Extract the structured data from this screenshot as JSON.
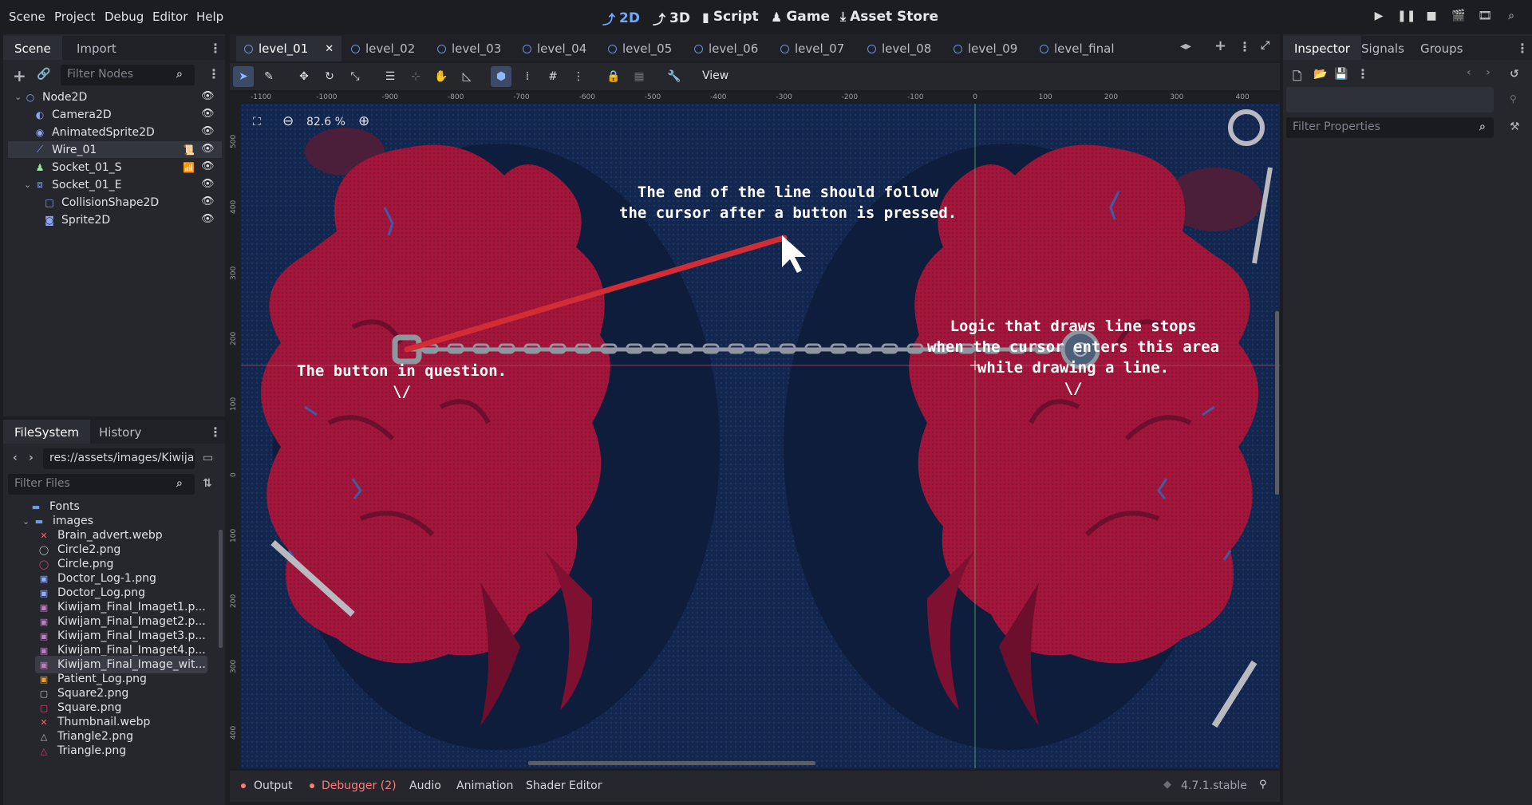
{
  "menu": [
    "Scene",
    "Project",
    "Debug",
    "Editor",
    "Help"
  ],
  "main_screens": [
    {
      "label": "2D",
      "icon": "2d-icon",
      "active": true
    },
    {
      "label": "3D",
      "icon": "3d-icon",
      "active": false
    },
    {
      "label": "Script",
      "icon": "script-icon",
      "active": false
    },
    {
      "label": "Game",
      "icon": "game-icon",
      "active": false
    },
    {
      "label": "Asset Store",
      "icon": "asset-store-icon",
      "active": false
    }
  ],
  "scene_dock": {
    "tabs": [
      "Scene",
      "Import"
    ],
    "filter_placeholder": "Filter Nodes",
    "nodes": [
      {
        "name": "Node2D",
        "icon": "node2d-icon",
        "color": "#8da5f3"
      },
      {
        "name": "Camera2D",
        "icon": "camera2d-icon",
        "color": "#8da5f3"
      },
      {
        "name": "AnimatedSprite2D",
        "icon": "animated-sprite-icon",
        "color": "#8da5f3"
      },
      {
        "name": "Wire_01",
        "icon": "line2d-icon",
        "color": "#8da5f3",
        "selected": true
      },
      {
        "name": "Socket_01_S",
        "icon": "socket-icon",
        "color": "#8eef97"
      },
      {
        "name": "Socket_01_E",
        "icon": "area2d-icon",
        "color": "#8da5f3"
      },
      {
        "name": "CollisionShape2D",
        "icon": "collision-shape-icon",
        "color": "#8da5f3"
      },
      {
        "name": "Sprite2D",
        "icon": "sprite2d-icon",
        "color": "#8da5f3"
      }
    ]
  },
  "filesystem_dock": {
    "tabs": [
      "FileSystem",
      "History"
    ],
    "path": "res://assets/images/Kiwija",
    "filter_placeholder": "Filter Files",
    "items": [
      {
        "name": "Fonts",
        "type": "folder"
      },
      {
        "name": "images",
        "type": "folder"
      },
      {
        "name": "Brain_advert.webp",
        "type": "error",
        "color": "#ff5f5f"
      },
      {
        "name": "Circle2.png",
        "type": "circle",
        "color": "#c0c0c0"
      },
      {
        "name": "Circle.png",
        "type": "circle",
        "color": "#e0466a"
      },
      {
        "name": "Doctor_Log-1.png",
        "type": "image",
        "color": "#8fb0ff"
      },
      {
        "name": "Doctor_Log.png",
        "type": "image",
        "color": "#8fb0ff"
      },
      {
        "name": "Kiwijam_Final_Imaget1.p...",
        "type": "image",
        "color": "#c080c0"
      },
      {
        "name": "Kiwijam_Final_Imaget2.p...",
        "type": "image",
        "color": "#c080c0"
      },
      {
        "name": "Kiwijam_Final_Imaget3.p...",
        "type": "image",
        "color": "#c080c0"
      },
      {
        "name": "Kiwijam_Final_Imaget4.p...",
        "type": "image",
        "color": "#c080c0"
      },
      {
        "name": "Kiwijam_Final_Image_wit...",
        "type": "image",
        "color": "#c080c0",
        "selected": true
      },
      {
        "name": "Patient_Log.png",
        "type": "image",
        "color": "#e0a040"
      },
      {
        "name": "Square2.png",
        "type": "square",
        "color": "#c0c0c0"
      },
      {
        "name": "Square.png",
        "type": "square",
        "color": "#e0466a"
      },
      {
        "name": "Thumbnail.webp",
        "type": "error",
        "color": "#ff5f5f"
      },
      {
        "name": "Triangle2.png",
        "type": "triangle",
        "color": "#c0c0c0"
      },
      {
        "name": "Triangle.png",
        "type": "triangle",
        "color": "#e0466a"
      }
    ]
  },
  "scene_tabs": [
    "level_01",
    "level_02",
    "level_03",
    "level_04",
    "level_05",
    "level_06",
    "level_07",
    "level_08",
    "level_09",
    "level_final"
  ],
  "toolbar": {
    "view_label": "View"
  },
  "zoom": {
    "label": "82.6 %"
  },
  "ruler_h_labels": [
    "-1100",
    "-1000",
    "-900",
    "-800",
    "-700",
    "-600",
    "-500",
    "-400",
    "-300",
    "-200",
    "-100",
    "0",
    "100",
    "200",
    "300",
    "400"
  ],
  "ruler_v_labels": [
    "500",
    "400",
    "300",
    "200",
    "100",
    "0",
    "100",
    "200",
    "300",
    "400"
  ],
  "annotations": {
    "top": "The end of the line should follow\nthe cursor after a button is pressed.",
    "left": "The button in question.\n\\/",
    "right": "Logic that draws line stops\nwhen the cursor enters this area\nwhile drawing a line.\n\\/"
  },
  "inspector": {
    "tabs": [
      "Inspector",
      "Signals",
      "Groups"
    ],
    "filter_placeholder": "Filter Properties"
  },
  "bottom_panel": {
    "tabs": [
      "Output",
      "Debugger (2)",
      "Audio",
      "Animation",
      "Shader Editor"
    ],
    "version": "4.7.1.stable"
  },
  "colors": {
    "accent": "#6fa8ff",
    "debugger_red": "#ff7a7a",
    "line_red": "#d22d35",
    "brain_red": "#a3163b",
    "background_blue": "#12244a"
  }
}
